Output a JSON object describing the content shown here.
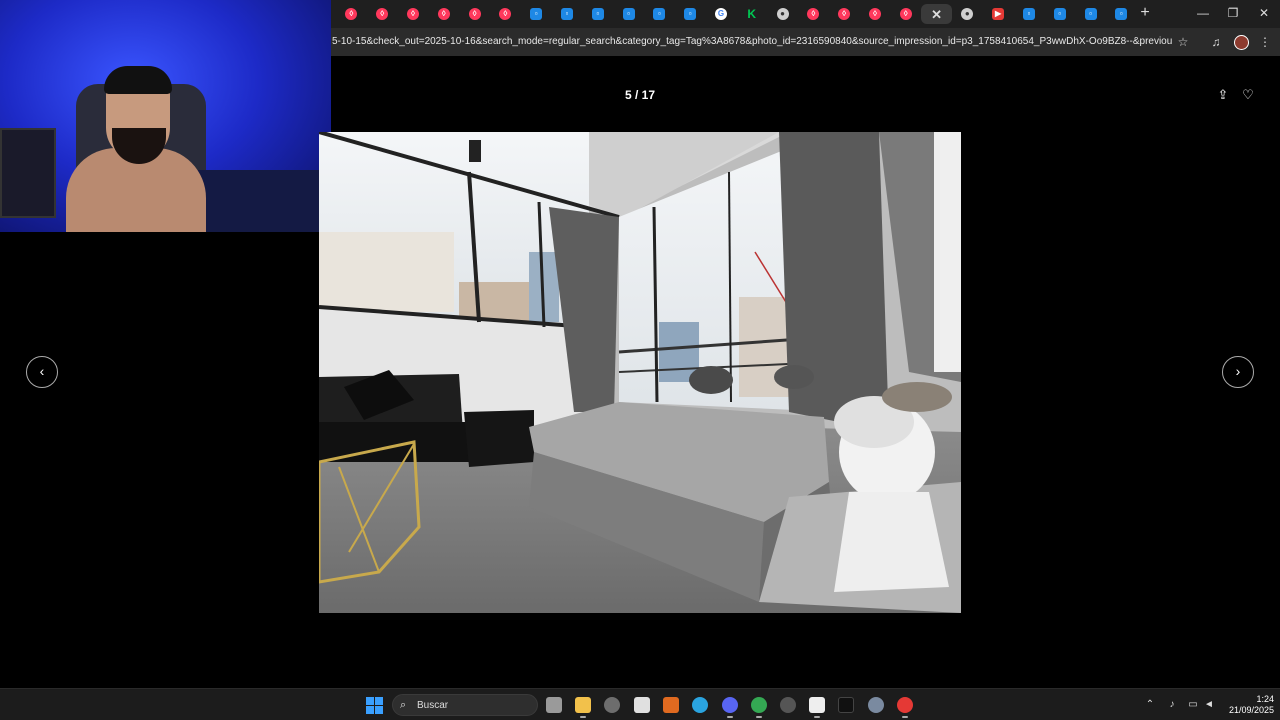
{
  "browser": {
    "tabs": [
      {
        "icon": "airbnb-icon",
        "kind": "airbnb",
        "glyph": "◊"
      },
      {
        "icon": "airbnb-icon",
        "kind": "airbnb",
        "glyph": "◊"
      },
      {
        "icon": "airbnb-icon",
        "kind": "airbnb",
        "glyph": "◊"
      },
      {
        "icon": "airbnb-icon",
        "kind": "airbnb",
        "glyph": "◊"
      },
      {
        "icon": "airbnb-icon",
        "kind": "airbnb",
        "glyph": "◊"
      },
      {
        "icon": "airbnb-icon",
        "kind": "airbnb",
        "glyph": "◊"
      },
      {
        "icon": "booking-icon",
        "kind": "booking",
        "glyph": "▫"
      },
      {
        "icon": "booking-icon",
        "kind": "booking",
        "glyph": "▫"
      },
      {
        "icon": "booking-icon",
        "kind": "booking",
        "glyph": "▫"
      },
      {
        "icon": "booking-icon",
        "kind": "booking",
        "glyph": "▫"
      },
      {
        "icon": "booking-icon",
        "kind": "booking",
        "glyph": "▫"
      },
      {
        "icon": "booking-icon",
        "kind": "booking",
        "glyph": "▫"
      },
      {
        "icon": "google-icon",
        "kind": "google",
        "glyph": "G"
      },
      {
        "icon": "kiwi-icon",
        "kind": "kiwi",
        "glyph": "K"
      },
      {
        "icon": "chrome-icon",
        "kind": "chrome",
        "glyph": "●"
      },
      {
        "icon": "airbnb-icon",
        "kind": "airbnb",
        "glyph": "◊"
      },
      {
        "icon": "airbnb-icon",
        "kind": "airbnb",
        "glyph": "◊"
      },
      {
        "icon": "airbnb-icon",
        "kind": "airbnb",
        "glyph": "◊"
      },
      {
        "icon": "airbnb-icon",
        "kind": "airbnb",
        "glyph": "◊"
      },
      {
        "icon": "close-icon",
        "kind": "close",
        "glyph": "✕",
        "active": true
      },
      {
        "icon": "chrome-icon",
        "kind": "chrome",
        "glyph": "●"
      },
      {
        "icon": "youtube-icon",
        "kind": "youtube",
        "glyph": "▶"
      },
      {
        "icon": "booking-icon",
        "kind": "booking",
        "glyph": "▫"
      },
      {
        "icon": "booking-icon",
        "kind": "booking",
        "glyph": "▫"
      },
      {
        "icon": "booking-icon",
        "kind": "booking",
        "glyph": "▫"
      },
      {
        "icon": "booking-icon",
        "kind": "booking",
        "glyph": "▫"
      }
    ],
    "url": "5-10-15&check_out=2025-10-16&search_mode=regular_search&category_tag=Tag%3A8678&photo_id=2316590840&source_impression_id=p3_1758410654_P3wwDhX-Oo9BZ8--&previous_page_secti..."
  },
  "viewer": {
    "counter": "5 / 17",
    "photo_description": "Bedroom with floor-to-ceiling windows, gray curtains, black leather sofa, bed and white bust sculpture"
  },
  "taskbar": {
    "search_placeholder": "Buscar",
    "time": "1:24",
    "date": "21/09/2025"
  },
  "colors": {
    "airbnb": "#ff385c",
    "booking": "#1e88e5",
    "webcam_light": "#2a3ae0"
  }
}
